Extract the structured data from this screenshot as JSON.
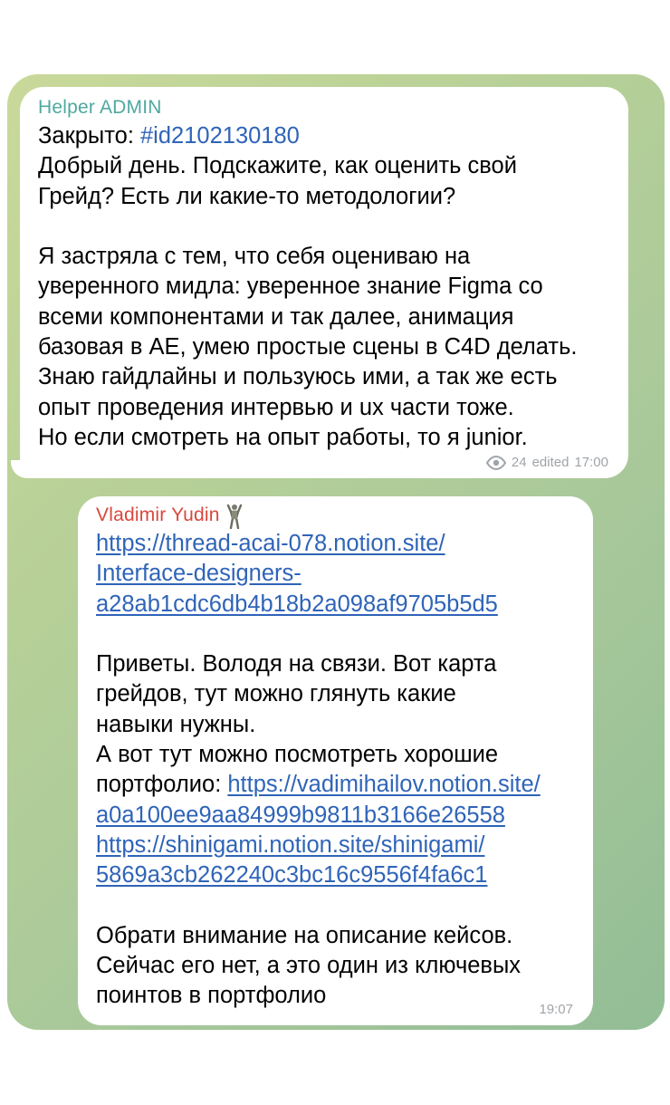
{
  "messages": [
    {
      "sender": "Helper ADMIN",
      "closed_label": "Закрыто: ",
      "hashtag": "#id2102130180",
      "body": "\nДобрый день. Подскажите, как оценить свой\nГрейд? Есть ли какие-то методологии?\n\nЯ застряла с тем, что себя оцениваю на\nуверенного мидла: уверенное знание Figma со\nвсеми компонентами и так далее, анимация\nбазовая в AE, умею простые сцены в C4D делать.\nЗнаю гайдлайны и пользуюсь ими, а так же есть\nопыт проведения интервью и ux части тоже.\nНо если смотреть на опыт работы, то я junior.",
      "views": "24",
      "edited_label": "edited",
      "time": "17:00",
      "sender_color": "#4fa9a0"
    },
    {
      "sender": "Vladimir Yudin",
      "sender_color": "#d9473c",
      "sender_icon": "person-figure-icon",
      "link_1": "https://thread-acai-078.notion.site/\nInterface-designers-\na28ab1cdc6db4b18b2a098af9705b5d5",
      "para_1": "\n\nПриветы. Володя на связи. Вот карта\nгрейдов, тут можно глянуть какие\nнавыки нужны.\nА вот тут можно посмотреть хорошие\nпортфолио: ",
      "link_2": "https://vadimihailov.notion.site/\na0a100ee9aa84999b9811b3166e26558",
      "link_3": "https://shinigami.notion.site/shinigami/\n5869a3cb262240c3bc16c9556f4fa6c1",
      "para_2": "\n\nОбрати внимание на описание кейсов.\nСейчас его нет, а это один из ключевых\nпоинтов в портфолио",
      "time": "19:07"
    }
  ],
  "colors": {
    "link": "#2f64b8",
    "meta": "#a0a4a8",
    "chat_bg_start": "#c9d99a",
    "chat_bg_end": "#93bd96"
  }
}
